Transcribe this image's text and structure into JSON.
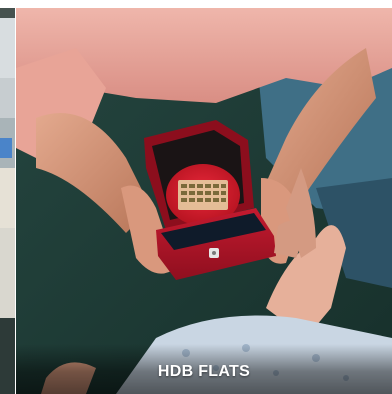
{
  "card": {
    "caption": "HDB FLATS"
  },
  "colors": {
    "ring_box": "#b5142a",
    "sleeve": "#e9a79d",
    "background": "#1f3a34",
    "caption_text": "#ffffff"
  }
}
